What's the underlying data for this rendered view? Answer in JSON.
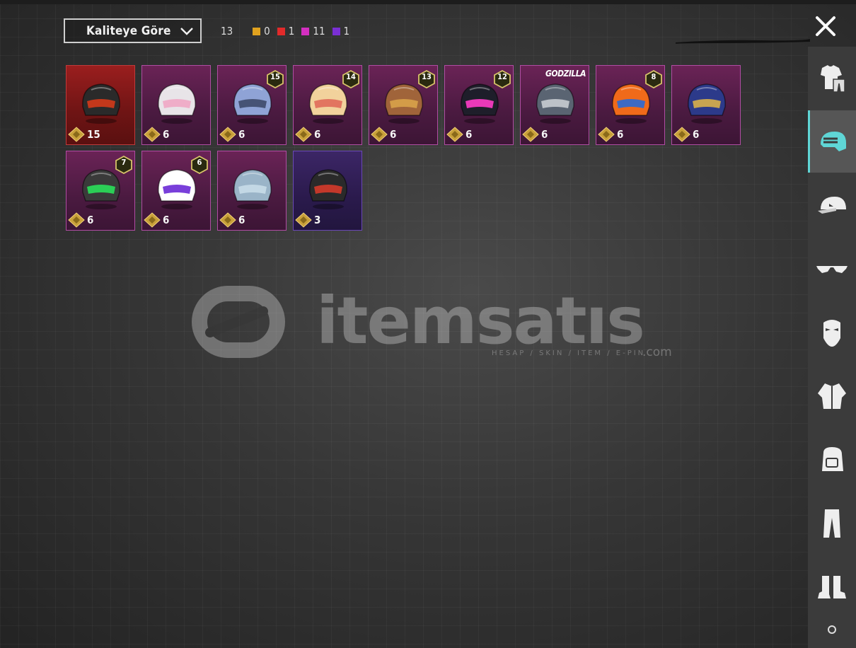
{
  "toolbar": {
    "sort_label": "Kaliteye Göre",
    "total_count": "13",
    "quality_counts": [
      {
        "color": "#e0a21f",
        "count": "0"
      },
      {
        "color": "#e22a2a",
        "count": "1"
      },
      {
        "color": "#d42fc1",
        "count": "11"
      },
      {
        "color": "#7a2fd4",
        "count": "1"
      }
    ],
    "close_icon": "close-icon"
  },
  "items": [
    {
      "qty": "15",
      "level": "",
      "tag": "",
      "rarity": "red",
      "helmet": "#2a2a2a",
      "accent": "#d43a1a"
    },
    {
      "qty": "6",
      "level": "",
      "tag": "",
      "rarity": "pink",
      "helmet": "#e8e4e8",
      "accent": "#f0a6c4"
    },
    {
      "qty": "6",
      "level": "15",
      "tag": "",
      "rarity": "pink",
      "helmet": "#8fa3d6",
      "accent": "#3e4a6a"
    },
    {
      "qty": "6",
      "level": "14",
      "tag": "",
      "rarity": "pink",
      "helmet": "#f2d29c",
      "accent": "#e06a5a"
    },
    {
      "qty": "6",
      "level": "13",
      "tag": "",
      "rarity": "pink",
      "helmet": "#a0643a",
      "accent": "#d8a24a"
    },
    {
      "qty": "6",
      "level": "12",
      "tag": "",
      "rarity": "pink",
      "helmet": "#1e1e2a",
      "accent": "#ff3cc8"
    },
    {
      "qty": "6",
      "level": "",
      "tag": "GODZILLA",
      "rarity": "pink",
      "helmet": "#5a6472",
      "accent": "#c8ccd2"
    },
    {
      "qty": "6",
      "level": "8",
      "tag": "",
      "rarity": "pink",
      "helmet": "#f06a1a",
      "accent": "#2a6ad6"
    },
    {
      "qty": "6",
      "level": "",
      "tag": "",
      "rarity": "pink",
      "helmet": "#2c3a8a",
      "accent": "#d8b04a"
    },
    {
      "qty": "6",
      "level": "7",
      "tag": "",
      "rarity": "pink",
      "helmet": "#3a3a3a",
      "accent": "#2ae05a"
    },
    {
      "qty": "6",
      "level": "6",
      "tag": "",
      "rarity": "pink",
      "helmet": "#ffffff",
      "accent": "#6a2ad6"
    },
    {
      "qty": "6",
      "level": "",
      "tag": "",
      "rarity": "pink",
      "helmet": "#9ab4c8",
      "accent": "#c8dce8"
    },
    {
      "qty": "3",
      "level": "",
      "tag": "",
      "rarity": "purple",
      "helmet": "#2a2a2a",
      "accent": "#d43a2a"
    }
  ],
  "sidebar": {
    "tabs": [
      {
        "name": "outfit-tab",
        "icon": "outfit-icon"
      },
      {
        "name": "helmet-tab",
        "icon": "helmet-icon",
        "active": true
      },
      {
        "name": "hat-tab",
        "icon": "cap-icon"
      },
      {
        "name": "glasses-tab",
        "icon": "glasses-icon"
      },
      {
        "name": "mask-tab",
        "icon": "mask-icon"
      },
      {
        "name": "jacket-tab",
        "icon": "jacket-icon"
      },
      {
        "name": "backpack-tab",
        "icon": "backpack-icon"
      },
      {
        "name": "pants-tab",
        "icon": "pants-icon"
      },
      {
        "name": "boots-tab",
        "icon": "boots-icon"
      }
    ]
  },
  "watermark": {
    "brand": "itemsatıs",
    "sub": "HESAP / SKIN / ITEM / E-PIN",
    "suffix": ".com"
  }
}
